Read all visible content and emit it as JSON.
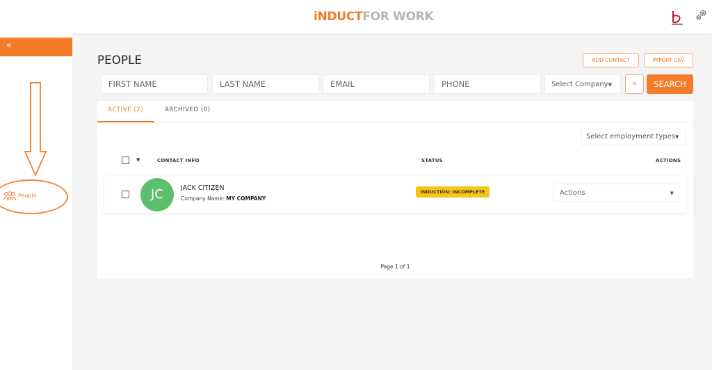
{
  "header": {
    "logo_part1": "iNDUCT",
    "logo_part2": "FOR WORK"
  },
  "sidebar": {
    "collapse_glyph": "«",
    "items": [
      {
        "label": "People",
        "icon": "people-icon"
      }
    ]
  },
  "page": {
    "title": "PEOPLE",
    "add_contact_label": "ADD CONTACT",
    "import_csv_label": "IMPORT CSV"
  },
  "filters": {
    "first_name_placeholder": "FIRST NAME",
    "last_name_placeholder": "LAST NAME",
    "email_placeholder": "EMAIL",
    "phone_placeholder": "PHONE",
    "company_select": "Select Company",
    "clear_label": "×",
    "search_label": "SEARCH"
  },
  "tabs": [
    {
      "label": "ACTIVE (2)",
      "active": true
    },
    {
      "label": "ARCHIVED (0)",
      "active": false
    }
  ],
  "employment_select": "Select employment types",
  "table": {
    "columns": [
      "CONTACT INFO",
      "STATUS",
      "ACTIONS"
    ],
    "rows": [
      {
        "initials": "JC",
        "name": "JACK CITIZEN",
        "company_label": "Company Name:",
        "company": "MY COMPANY",
        "status": "INDUCTION: INCOMPLETE",
        "actions": "Actions"
      }
    ]
  },
  "pagination": "Page 1 of 1",
  "colors": {
    "accent": "#f47c28",
    "avatar": "#5cbf6d",
    "status_badge": "#f5c518"
  }
}
